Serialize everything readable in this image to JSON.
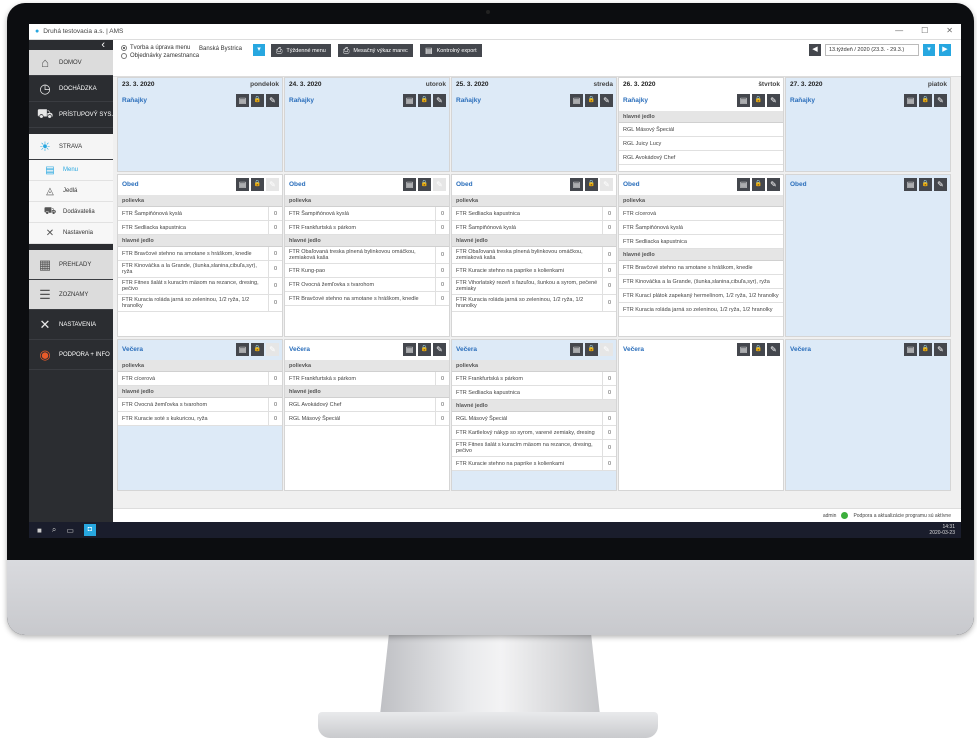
{
  "window": {
    "title": "Druhá testovacia a.s. | AMS"
  },
  "sidebar": {
    "items": [
      "DOMOV",
      "DOCHÁDZKA",
      "PRÍSTUPOVÝ SYS.",
      "STRAVA",
      "PREHĽADY",
      "ZOZNAMY",
      "NASTAVENIA",
      "PODPORA + INFO"
    ],
    "sub": [
      "Menu",
      "Jedlá",
      "Dodávatelia",
      "Nastavenia"
    ]
  },
  "toolbar": {
    "radio1": "Tvorba a úprava menu",
    "radio2": "Objednávky zamestnanca",
    "location": "Banská Bystrica",
    "btn1": "Týždenné menu",
    "btn2": "Mesačný výkaz marec",
    "btn3": "Kontrolný export",
    "week": "13.týždeň / 2020 (23.3. - 29.3.)"
  },
  "status": {
    "user": "admin",
    "text": "Podpora a aktualizácie programu sú aktívne"
  },
  "taskbar": {
    "time": "14:31",
    "date": "2020-03-23"
  },
  "colors": {
    "accent": "#27a7e0",
    "card_blue": "#ddeaf7",
    "sidebar": "#2b2d31"
  },
  "days": [
    {
      "date": "23. 3. 2020",
      "day": "pondelok",
      "ranajky": {
        "title": "Raňajky",
        "sections": []
      },
      "obed": {
        "title": "Obed",
        "sections": [
          {
            "name": "polievka",
            "items": [
              [
                "FTR Šampiňónová kyslá",
                "0"
              ],
              [
                "FTR Sedliacka kapustnica",
                "0"
              ]
            ]
          },
          {
            "name": "hlavné jedlo",
            "items": [
              [
                "FTR Bravčové stehno na smotane s hráškom, knedle",
                "0"
              ],
              [
                "FTR Kinováčka a la Grande, (šunka,slanina,cibuľa,syr), ryža",
                "0"
              ],
              [
                "FTR Fitnes šalát s kuracím mäsom na rezance, dresing, pečivo",
                "0"
              ],
              [
                "FTR Kuracia roláda jarná so zeleninou, 1/2 ryža, 1/2 hranolky",
                "0"
              ]
            ]
          }
        ]
      },
      "vecera": {
        "title": "Večera",
        "sections": [
          {
            "name": "polievka",
            "items": [
              [
                "FTR cícerová",
                "0"
              ]
            ]
          },
          {
            "name": "hlavné jedlo",
            "items": [
              [
                "FTR Ovocná žemľovka s tvarohom",
                "0"
              ],
              [
                "FTR Kuracie soté s kukuricou, ryža",
                "0"
              ]
            ]
          }
        ]
      }
    },
    {
      "date": "24. 3. 2020",
      "day": "utorok",
      "ranajky": {
        "title": "Raňajky",
        "sections": []
      },
      "obed": {
        "title": "Obed",
        "sections": [
          {
            "name": "polievka",
            "items": [
              [
                "FTR Šampiňónová kyslá",
                "0"
              ],
              [
                "FTR Frankfurtská s párkom",
                "0"
              ]
            ]
          },
          {
            "name": "hlavné jedlo",
            "items": [
              [
                "FTR Obaľovaná treska plnená bylinkovou omáčkou, zemiaková kaša",
                "0"
              ],
              [
                "FTR Kung-pao",
                "0"
              ],
              [
                "FTR Ovocná žemľovka s tvarohom",
                "0"
              ],
              [
                "FTR Bravčové stehno na smotane s hráškom, knedle",
                "0"
              ]
            ]
          }
        ]
      },
      "vecera": {
        "title": "Večera",
        "sections": [
          {
            "name": "polievka",
            "items": [
              [
                "FTR Frankfurtská s párkom",
                "0"
              ]
            ]
          },
          {
            "name": "hlavné jedlo",
            "items": [
              [
                "RGL Avokádový Chef",
                "0"
              ],
              [
                "RGL Mäsový Špeciál",
                "0"
              ]
            ]
          }
        ]
      }
    },
    {
      "date": "25. 3. 2020",
      "day": "streda",
      "ranajky": {
        "title": "Raňajky",
        "sections": []
      },
      "obed": {
        "title": "Obed",
        "sections": [
          {
            "name": "polievka",
            "items": [
              [
                "FTR Sedliacka kapustnica",
                "0"
              ],
              [
                "FTR Šampiňónová kyslá",
                "0"
              ]
            ]
          },
          {
            "name": "hlavné jedlo",
            "items": [
              [
                "FTR Obaľovaná treska plnená bylinkovou omáčkou, zemiaková kaša",
                "0"
              ],
              [
                "FTR Kuracie stehno na paprike s kolienkami",
                "0"
              ],
              [
                "FTR Vihorlatský rezeň s fazuľou, šunkou a syrom, pečené zemiaky",
                "0"
              ],
              [
                "FTR Kuracia roláda jarná so zeleninou, 1/2 ryža, 1/2 hranolky",
                "0"
              ]
            ]
          }
        ]
      },
      "vecera": {
        "title": "Večera",
        "sections": [
          {
            "name": "polievka",
            "items": [
              [
                "FTR Frankfurtská s párkom",
                "0"
              ],
              [
                "FTR Sedliacka kapustnica",
                "0"
              ]
            ]
          },
          {
            "name": "hlavné jedlo",
            "items": [
              [
                "RGL Mäsový Špeciál",
                "0"
              ],
              [
                "FTR Kartlelový nákyp so syrom, varené zemiaky, dresing",
                "0"
              ],
              [
                "FTR Fitnes šalát s kuracím mäsom na rezance, dresing, pečivo",
                "0"
              ],
              [
                "FTR Kuracie stehno na paprike s kolienkami",
                "0"
              ]
            ]
          }
        ]
      }
    },
    {
      "date": "26. 3. 2020",
      "day": "štvrtok",
      "ranajky": {
        "title": "Raňajky",
        "sections": [
          {
            "name": "hlavné jedlo",
            "items": [
              [
                "RGL Mäsový Špeciál",
                ""
              ],
              [
                "RGL Juicy Lucy",
                ""
              ],
              [
                "RGL Avokádový Chef",
                ""
              ]
            ]
          }
        ]
      },
      "obed": {
        "title": "Obed",
        "sections": [
          {
            "name": "polievka",
            "items": [
              [
                "FTR cícerová",
                ""
              ],
              [
                "FTR Šampiňónová kyslá",
                ""
              ],
              [
                "FTR Sedliacka kapustnica",
                ""
              ]
            ]
          },
          {
            "name": "hlavné jedlo",
            "items": [
              [
                "FTR Bravčové stehno na smotane s hráškom, knedle",
                ""
              ],
              [
                "FTR Kinováčka a la Grande, (šunka,slanina,cibuľa,syr), ryža",
                ""
              ],
              [
                "FTR Kurací plátok zapekaný hermelínom, 1/2 ryža, 1/2 hranolky",
                ""
              ],
              [
                "FTR Kuracia roláda jarná so zeleninou, 1/2 ryža, 1/2 hranolky",
                ""
              ]
            ]
          }
        ]
      },
      "vecera": {
        "title": "Večera",
        "sections": []
      }
    },
    {
      "date": "27. 3. 2020",
      "day": "piatok",
      "ranajky": {
        "title": "Raňajky",
        "sections": []
      },
      "obed": {
        "title": "Obed",
        "sections": []
      },
      "vecera": {
        "title": "Večera",
        "sections": []
      }
    }
  ]
}
